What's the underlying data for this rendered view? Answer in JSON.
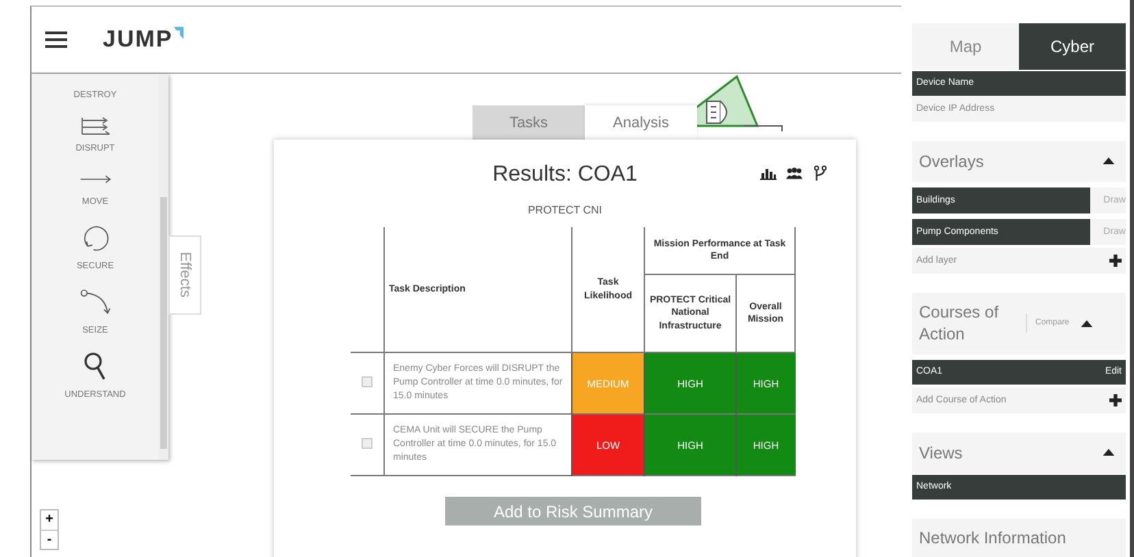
{
  "header": {
    "logo": "JUMP"
  },
  "effects": {
    "tab_label": "Effects",
    "items": [
      {
        "label": "DESTROY",
        "kind": "destroy"
      },
      {
        "label": "DISRUPT",
        "kind": "disrupt"
      },
      {
        "label": "MOVE",
        "kind": "move"
      },
      {
        "label": "SECURE",
        "kind": "secure"
      },
      {
        "label": "SEIZE",
        "kind": "seize"
      },
      {
        "label": "UNDERSTAND",
        "kind": "understand"
      }
    ]
  },
  "zoom_controls": [
    "+",
    "-"
  ],
  "results": {
    "tabs": [
      {
        "label": "Tasks",
        "selected": false
      },
      {
        "label": "Analysis",
        "selected": true
      }
    ],
    "title": "Results: COA1",
    "subtitle": "PROTECT CNI",
    "table": {
      "columns": {
        "description": "Task Description",
        "likelihood": "Task Likelihood",
        "group": "Mission Performance at Task End",
        "protect": "PROTECT Critical National Infrastructure",
        "overall": "Overall Mission"
      },
      "rows": [
        {
          "checked": false,
          "description": "Enemy Cyber Forces will DISRUPT the Pump Controller at time 0.0 minutes, for 15.0 minutes",
          "likelihood": {
            "text": "MEDIUM",
            "color": "#f6a623"
          },
          "protect": {
            "text": "HIGH",
            "color": "#138a13"
          },
          "overall": {
            "text": "HIGH",
            "color": "#138a13"
          }
        },
        {
          "checked": false,
          "description": "CEMA Unit will SECURE the Pump Controller at time 0.0 minutes, for 15.0 minutes",
          "likelihood": {
            "text": "LOW",
            "color": "#f01c1c"
          },
          "protect": {
            "text": "HIGH",
            "color": "#138a13"
          },
          "overall": {
            "text": "HIGH",
            "color": "#138a13"
          }
        }
      ]
    },
    "button": "Add to Risk Summary"
  },
  "sidebar": {
    "tabs": [
      {
        "label": "Map",
        "selected": false
      },
      {
        "label": "Cyber",
        "selected": true
      }
    ],
    "device_fields": [
      {
        "label": "Device Name",
        "selected": true
      },
      {
        "label": "Device IP Address",
        "selected": false
      }
    ],
    "overlays": {
      "title": "Overlays",
      "expanded": true,
      "layers": [
        {
          "name": "Buildings",
          "action": "Draw"
        },
        {
          "name": "Pump Components",
          "action": "Draw"
        }
      ],
      "add": "Add layer"
    },
    "courses": {
      "title": "Courses of Action",
      "compare": "Compare",
      "expanded": true,
      "items": [
        {
          "name": "COA1",
          "action": "Edit"
        }
      ],
      "add": "Add Course of Action"
    },
    "views": {
      "title": "Views",
      "expanded": true,
      "items": [
        "Network"
      ]
    },
    "network_info": {
      "title": "Network Information"
    }
  }
}
